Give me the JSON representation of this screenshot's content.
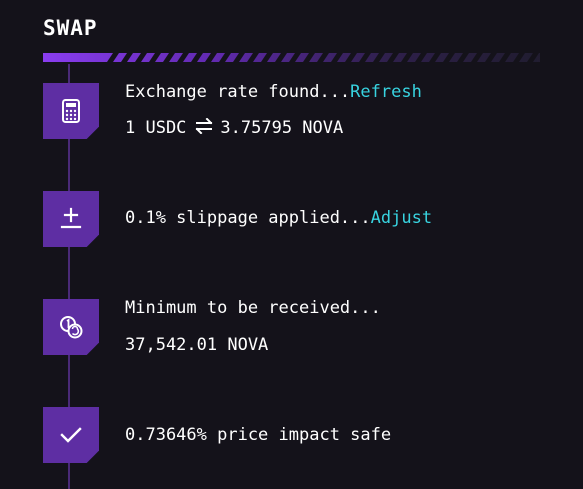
{
  "header": {
    "title": "SWAP"
  },
  "colors": {
    "accent": "#5e2ea3",
    "link": "#38d3e0",
    "background": "#14121a",
    "line": "#4a2a78"
  },
  "steps": [
    {
      "icon": "calculator-icon",
      "status": "Exchange rate found...",
      "action": "Refresh",
      "rate_from": "1 USDC",
      "rate_to": "3.75795 NOVA"
    },
    {
      "icon": "plus-minus-icon",
      "status": "0.1% slippage applied...",
      "action": "Adjust"
    },
    {
      "icon": "coins-icon",
      "status": "Minimum to be received...",
      "detail": "37,542.01 NOVA"
    },
    {
      "icon": "check-icon",
      "status": "0.73646% price impact safe"
    }
  ]
}
